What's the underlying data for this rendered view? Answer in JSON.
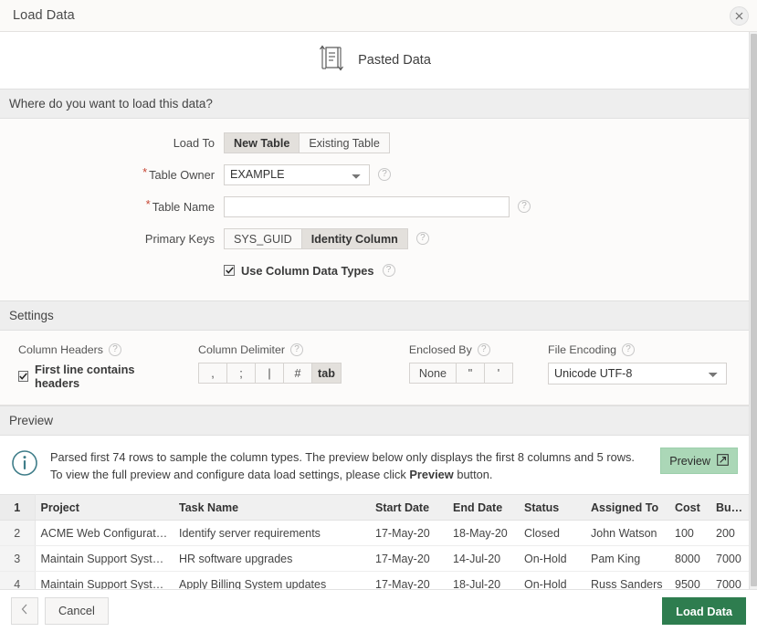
{
  "window": {
    "title": "Load Data",
    "close_icon": "close-icon"
  },
  "source": {
    "icon": "pasted-data-icon",
    "label": "Pasted Data"
  },
  "sections": {
    "where": "Where do you want to load this data?",
    "settings": "Settings",
    "preview": "Preview"
  },
  "form": {
    "load_to": {
      "label": "Load To",
      "options": [
        "New Table",
        "Existing Table"
      ],
      "selected": "New Table"
    },
    "table_owner": {
      "label": "Table Owner",
      "required": true,
      "value": "EXAMPLE",
      "options": [
        "EXAMPLE"
      ],
      "help": "?"
    },
    "table_name": {
      "label": "Table Name",
      "required": true,
      "value": "",
      "placeholder": "",
      "help": "?"
    },
    "primary_keys": {
      "label": "Primary Keys",
      "options": [
        "SYS_GUID",
        "Identity Column"
      ],
      "selected": "Identity Column",
      "help": "?"
    },
    "use_column_data_types": {
      "label": "Use Column Data Types",
      "checked": true,
      "help": "?"
    }
  },
  "settings": {
    "column_headers": {
      "title": "Column Headers",
      "help": "?",
      "checkbox_label": "First line contains headers",
      "checked": true
    },
    "column_delimiter": {
      "title": "Column Delimiter",
      "help": "?",
      "options": [
        ",",
        ";",
        "|",
        "#",
        "tab"
      ],
      "selected": "tab"
    },
    "enclosed_by": {
      "title": "Enclosed By",
      "help": "?",
      "options": [
        "None",
        "\"",
        "'"
      ],
      "selected": "None"
    },
    "file_encoding": {
      "title": "File Encoding",
      "help": "?",
      "value": "Unicode UTF-8",
      "options": [
        "Unicode UTF-8"
      ]
    }
  },
  "preview": {
    "info_icon": "info-icon",
    "message_part1": "Parsed first 74 rows to sample the column types. The preview below only displays the first 8 columns and 5 rows. To view the full preview and configure data load settings, please click ",
    "message_bold": "Preview",
    "message_part2": " button.",
    "button_label": "Preview",
    "button_icon": "external-link-icon"
  },
  "table": {
    "header_rownum": "1",
    "columns": [
      "Project",
      "Task Name",
      "Start Date",
      "End Date",
      "Status",
      "Assigned To",
      "Cost",
      "Budget"
    ],
    "rows": [
      {
        "num": "2",
        "cells": [
          "ACME Web Configuration",
          "Identify server requirements",
          "17-May-20",
          "18-May-20",
          "Closed",
          "John Watson",
          "100",
          "200"
        ]
      },
      {
        "num": "3",
        "cells": [
          "Maintain Support Systems",
          "HR software upgrades",
          "17-May-20",
          "14-Jul-20",
          "On-Hold",
          "Pam King",
          "8000",
          "7000"
        ]
      },
      {
        "num": "4",
        "cells": [
          "Maintain Support Systems",
          "Apply Billing System updates",
          "17-May-20",
          "18-Jul-20",
          "On-Hold",
          "Russ Sanders",
          "9500",
          "7000"
        ]
      }
    ]
  },
  "footer": {
    "back_icon": "chevron-left-icon",
    "cancel_label": "Cancel",
    "submit_label": "Load Data"
  },
  "colors": {
    "primary_button": "#2e7d4f",
    "preview_button": "#abd7b7",
    "required_star": "#c74634",
    "info_icon": "#3f7d89"
  }
}
